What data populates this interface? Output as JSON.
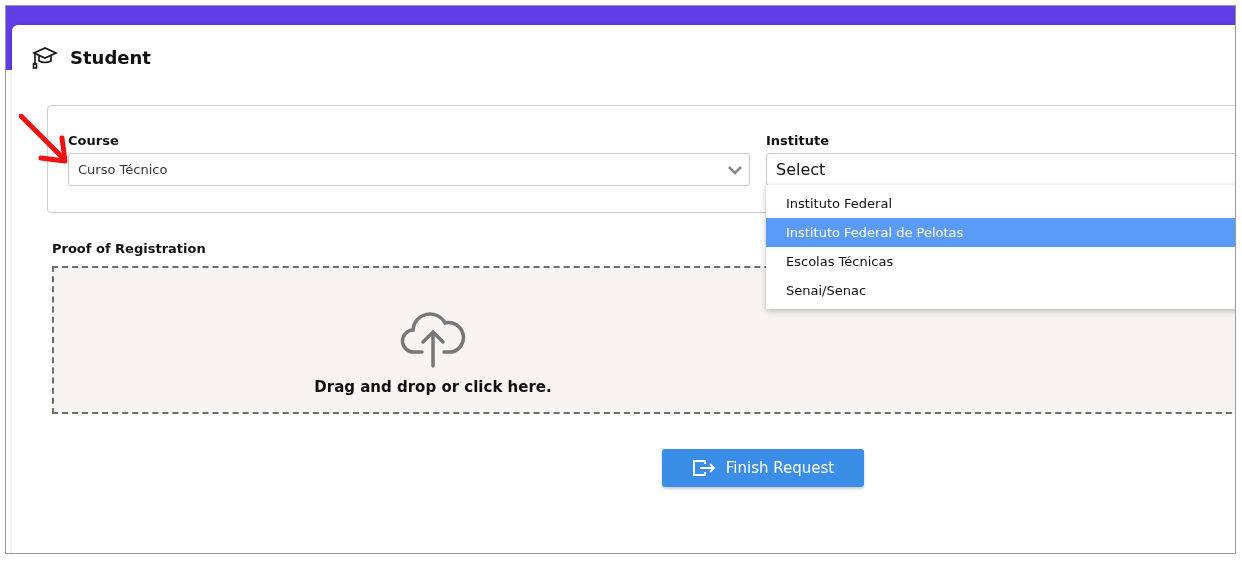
{
  "header": {
    "title": "Student"
  },
  "course": {
    "label": "Course",
    "value": "Curso Técnico"
  },
  "institute": {
    "label": "Institute",
    "placeholder": "Select",
    "expanded": true,
    "options": [
      {
        "label": "Instituto Federal",
        "selected": false
      },
      {
        "label": "Instituto Federal de Pelotas",
        "selected": true
      },
      {
        "label": "Escolas Técnicas",
        "selected": false
      },
      {
        "label": "Senai/Senac",
        "selected": false
      }
    ]
  },
  "proof": {
    "label": "Proof of Registration",
    "hint": "Drag and drop or click here."
  },
  "submit": {
    "label": "Finish Request"
  }
}
